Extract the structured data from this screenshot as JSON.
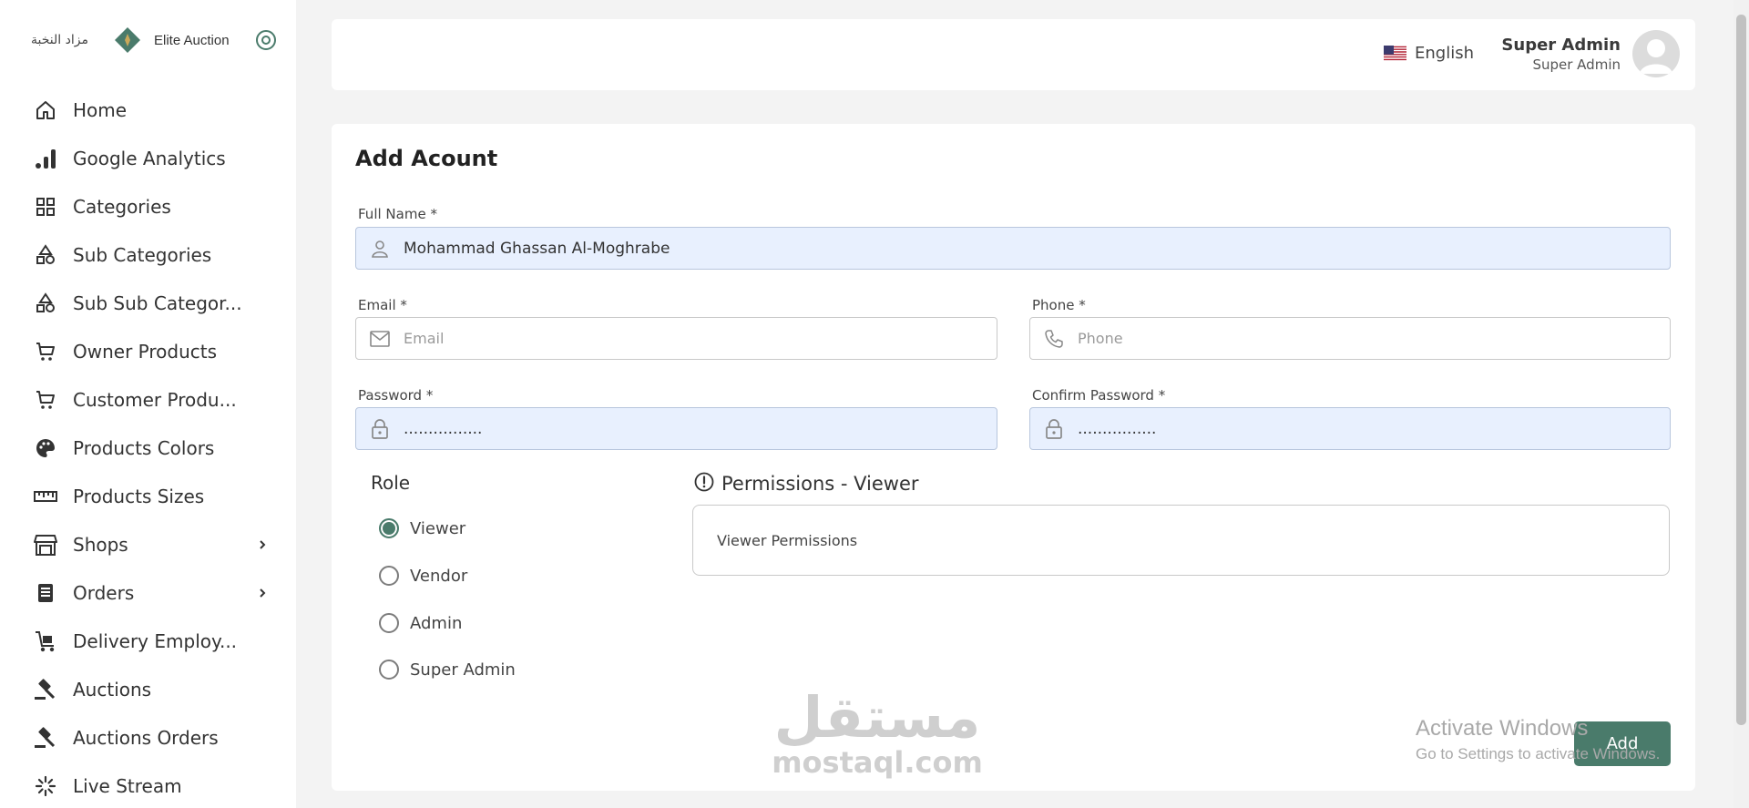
{
  "brand": {
    "arabic_name": "مزاد النخبة",
    "english_name": "Elite Auction"
  },
  "sidebar": {
    "items": [
      {
        "label": "Home",
        "icon": "home-icon"
      },
      {
        "label": "Google Analytics",
        "icon": "analytics-icon"
      },
      {
        "label": "Categories",
        "icon": "categories-icon"
      },
      {
        "label": "Sub Categories",
        "icon": "shapes-icon"
      },
      {
        "label": "Sub Sub Categor...",
        "icon": "shapes-icon"
      },
      {
        "label": "Owner Products",
        "icon": "cart-icon"
      },
      {
        "label": "Customer Produ...",
        "icon": "cart-icon"
      },
      {
        "label": "Products Colors",
        "icon": "palette-icon"
      },
      {
        "label": "Products Sizes",
        "icon": "ruler-icon"
      },
      {
        "label": "Shops",
        "icon": "store-icon",
        "expandable": true
      },
      {
        "label": "Orders",
        "icon": "receipt-icon",
        "expandable": true
      },
      {
        "label": "Delivery Employ...",
        "icon": "delivery-icon"
      },
      {
        "label": "Auctions",
        "icon": "gavel-icon"
      },
      {
        "label": "Auctions Orders",
        "icon": "gavel-icon"
      },
      {
        "label": "Live Stream",
        "icon": "live-stream-icon"
      }
    ]
  },
  "header": {
    "language": "English",
    "user_name": "Super Admin",
    "user_role": "Super Admin"
  },
  "form": {
    "title": "Add Acount",
    "full_name_label": "Full Name *",
    "full_name_value": "Mohammad Ghassan Al-Moghrabe",
    "email_label": "Email *",
    "email_placeholder": "Email",
    "phone_label": "Phone *",
    "phone_placeholder": "Phone",
    "password_label": "Password *",
    "password_value": "................",
    "confirm_password_label": "Confirm Password *",
    "confirm_password_value": "................",
    "role_title": "Role",
    "roles": [
      "Viewer",
      "Vendor",
      "Admin",
      "Super Admin"
    ],
    "selected_role": "Viewer",
    "permissions_title": "Permissions - Viewer",
    "permissions_text": "Viewer Permissions",
    "add_button": "Add"
  },
  "watermark": {
    "arabic": "مستقل",
    "english": "mostaql.com"
  },
  "os_notice": {
    "line1": "Activate Windows",
    "line2": "Go to Settings to activate Windows."
  },
  "colors": {
    "accent": "#4a7b6b",
    "filled_field": "#e8f0fe",
    "background": "#f3f3f3"
  }
}
